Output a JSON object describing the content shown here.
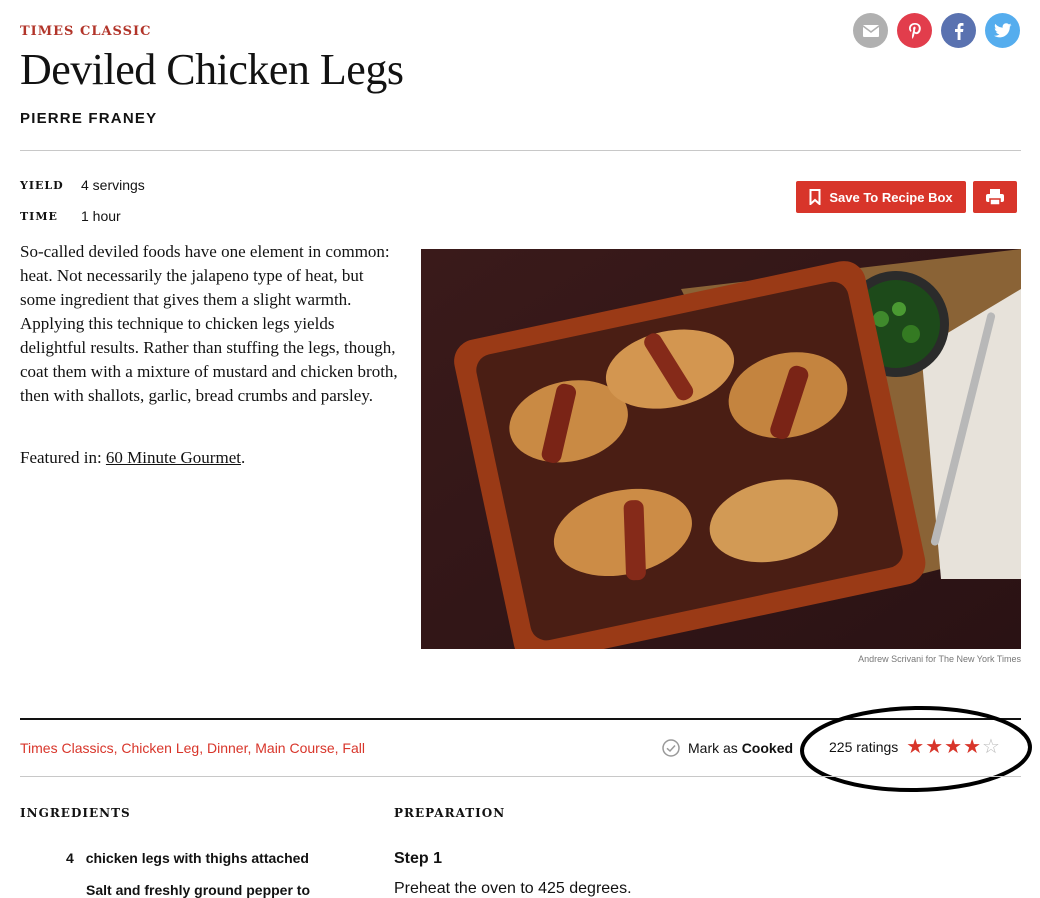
{
  "kicker": "TIMES CLASSIC",
  "title": "Deviled Chicken Legs",
  "author": "PIERRE FRANEY",
  "share": [
    {
      "name": "email-icon",
      "color": "#b0b0b0"
    },
    {
      "name": "pinterest-icon",
      "color": "#e23d4c"
    },
    {
      "name": "facebook-icon",
      "color": "#5a72b0"
    },
    {
      "name": "twitter-icon",
      "color": "#55adee"
    }
  ],
  "meta": {
    "yield_label": "YIELD",
    "yield_value": "4 servings",
    "time_label": "TIME",
    "time_value": "1 hour"
  },
  "actions": {
    "save_label": "Save To Recipe Box",
    "print_icon": "printer-icon",
    "accent": "#d8352a"
  },
  "description": "So-called deviled foods have one element in common: heat. Not necessarily the jalapeno type of heat, but some ingredient that gives them a slight warmth. Applying this technique to chicken legs yields delightful results. Rather than stuffing the legs, though, coat them with a mixture of mustard and chicken broth, then with shallots, garlic, bread crumbs and parsley.",
  "featured": {
    "prefix": "Featured in: ",
    "link": "60 Minute Gourmet",
    "suffix": "."
  },
  "photo_credit": "Andrew Scrivani for The New York Times",
  "tags": [
    "Times Classics",
    "Chicken Leg",
    "Dinner",
    "Main Course",
    "Fall"
  ],
  "mark_cooked": {
    "prefix": "Mark as ",
    "bold": "Cooked"
  },
  "ratings": {
    "count_text": "225 ratings",
    "stars": 4,
    "max": 5
  },
  "ingredients": {
    "heading": "INGREDIENTS",
    "items": [
      {
        "qty": "4",
        "text": "chicken legs with thighs attached"
      },
      {
        "qty": "",
        "text": "Salt and freshly ground pepper to"
      }
    ]
  },
  "preparation": {
    "heading": "PREPARATION",
    "step_title": "Step 1",
    "step_text": "Preheat the oven to 425 degrees."
  }
}
